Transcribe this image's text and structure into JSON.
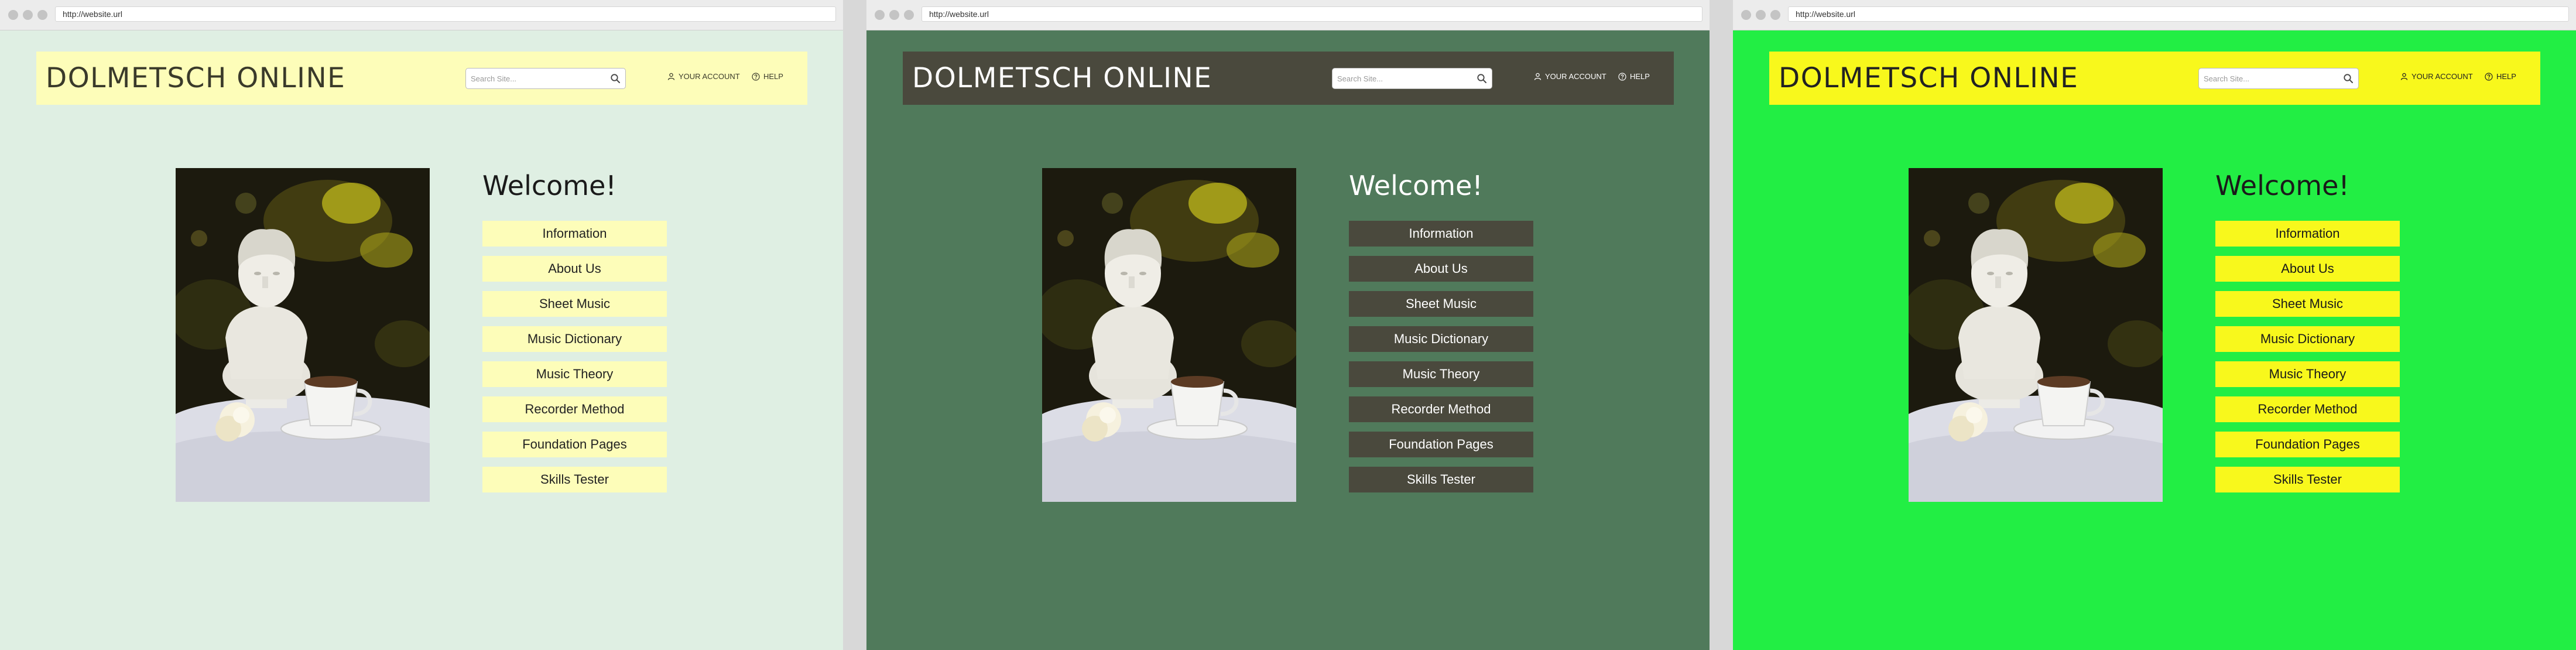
{
  "url": "http://website.url",
  "site": {
    "title": "DOLMETSCH ONLINE",
    "search_placeholder": "Search Site...",
    "account_label": "YOUR ACCOUNT",
    "help_label": "HELP",
    "welcome": "Welcome!",
    "menu": [
      {
        "label": "Information"
      },
      {
        "label": "About Us"
      },
      {
        "label": "Sheet Music"
      },
      {
        "label": "Music Dictionary"
      },
      {
        "label": "Music Theory"
      },
      {
        "label": "Recorder Method"
      },
      {
        "label": "Foundation Pages"
      },
      {
        "label": "Skills Tester"
      }
    ]
  },
  "themes": [
    {
      "page_bg": "#dfefe3",
      "header_bg": "#fdfdb9",
      "header_text": "#3a3a2a",
      "button_bg": "#fdfdb9",
      "button_text": "#222222",
      "welcome_text": "#1a1a1a"
    },
    {
      "page_bg": "#507a5b",
      "header_bg": "#4a493d",
      "header_text": "#ffffff",
      "button_bg": "#4a493d",
      "button_text": "#ffffff",
      "welcome_text": "#ffffff"
    },
    {
      "page_bg": "#22ee44",
      "header_bg": "#f8f81c",
      "header_text": "#222222",
      "button_bg": "#f8f81c",
      "button_text": "#1a1a1a",
      "welcome_text": "#1a1a1a"
    }
  ]
}
